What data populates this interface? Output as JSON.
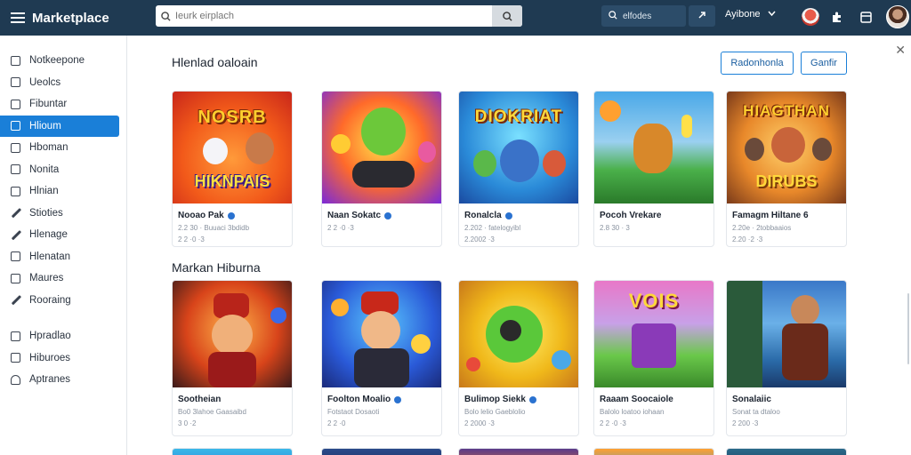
{
  "app": {
    "title": "Marketplace"
  },
  "search": {
    "placeholder": "Ieurk eirplach"
  },
  "topbar": {
    "pill_label": "elfodes",
    "user_label": "Ayibone",
    "colors": {
      "bar": "#1f3a52",
      "accent": "#1a7fd8"
    }
  },
  "sidebar": {
    "items": [
      {
        "label": "Notkeepone",
        "icon": "square-icon"
      },
      {
        "label": "Ueolcs",
        "icon": "square-icon"
      },
      {
        "label": "Fibuntar",
        "icon": "square-icon"
      },
      {
        "label": "Hlioum",
        "icon": "square-icon",
        "active": true
      },
      {
        "label": "Hboman",
        "icon": "square-icon"
      },
      {
        "label": "Nonita",
        "icon": "square-icon"
      },
      {
        "label": "Hlnian",
        "icon": "square-icon"
      },
      {
        "label": "Stioties",
        "icon": "pen-icon"
      },
      {
        "label": "Hlenage",
        "icon": "pen-icon"
      },
      {
        "label": "Hlenatan",
        "icon": "square-icon"
      },
      {
        "label": "Maures",
        "icon": "square-icon"
      },
      {
        "label": "Rooraing",
        "icon": "pen-icon"
      },
      {
        "label": "Hpradlao",
        "icon": "square-icon"
      },
      {
        "label": "Hiburoes",
        "icon": "bank-icon"
      },
      {
        "label": "Aptranes",
        "icon": "person-icon"
      }
    ]
  },
  "main": {
    "section1": {
      "title": "Hlenlad oaloain",
      "buttons": [
        "Radonhonla",
        "Ganfir"
      ],
      "cards": [
        {
          "name": "Nooao Pak",
          "meta": "2.2 30 ·  Buuaci 3bdidb",
          "meta2": "2 2 ·0 ·3",
          "thumb_text": "NOSRB",
          "thumb_text2": "HIKNPAIS"
        },
        {
          "name": "Naan Sokatc",
          "meta": "2 2 ·0 ·3",
          "meta2": "",
          "thumb_text": "",
          "thumb_text2": ""
        },
        {
          "name": "Ronalcla",
          "meta": "2.202 · fatelogyibl",
          "meta2": "2.2002 ·3",
          "thumb_text": "DIOKRIAT",
          "thumb_text2": ""
        },
        {
          "name": "Pocoh Vrekare",
          "meta": "2.8 30 ·  3",
          "meta2": "",
          "thumb_text": "",
          "thumb_text2": ""
        },
        {
          "name": "Famagm Hiltane 6",
          "meta": "2.20e · 2tobbaaios",
          "meta2": "2.20 ·2 ·3",
          "thumb_text": "HIAGTHAN",
          "thumb_text2": "DIRUBS"
        }
      ]
    },
    "section2": {
      "title": "Markan Hiburna",
      "cards": [
        {
          "name": "Sootheian",
          "meta": "Bo0 3lahoe Gaasaibd",
          "meta2": "3 0 ·2",
          "thumb_text": ""
        },
        {
          "name": "Foolton Moalio",
          "meta": "Fotstaot Dosaoti",
          "meta2": "2 2 ·0",
          "thumb_text": ""
        },
        {
          "name": "Bulimop Siekk",
          "meta": "Bolo lelio Gaeblolio",
          "meta2": "2 2000 ·3",
          "thumb_text": ""
        },
        {
          "name": "Raaam Soocaiole",
          "meta": "Balolo loatoo iohaan",
          "meta2": "2 2 ·0 ·3",
          "thumb_text": "VOIS"
        },
        {
          "name": "Sonalaiic",
          "meta": "Sonat ta dtaloo",
          "meta2": "2 200 ·3",
          "thumb_text": ""
        }
      ]
    }
  }
}
